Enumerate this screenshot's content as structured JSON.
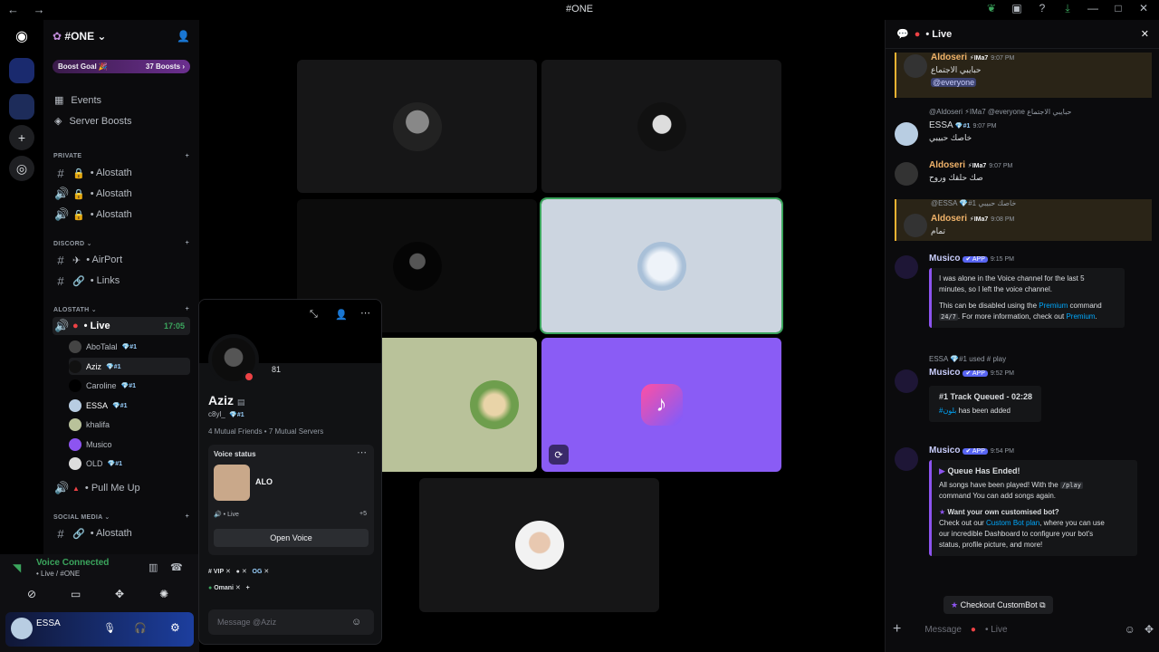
{
  "window": {
    "title": "#ONE",
    "nav": "← →"
  },
  "titlebar_icons": [
    "leaf-icon",
    "inbox-icon",
    "help-icon",
    "download-icon"
  ],
  "window_controls": [
    "—",
    "□",
    "✕"
  ],
  "server": {
    "name": "#ONE",
    "boost_label": "Boost Goal 🎉",
    "boost_count": "37 Boosts",
    "events": "Events",
    "server_boosts": "Server Boosts"
  },
  "categories": {
    "private": "PRIVATE",
    "discord": "DISCORD ⌄",
    "alostath": "ALOSTATH ⌄",
    "social": "SOCIAL MEDIA ⌄"
  },
  "channels": {
    "private": [
      "• Alostath",
      "• Alostath",
      "• Alostath"
    ],
    "discord": [
      "• AirPort",
      "• Links"
    ],
    "live": "• Live",
    "live_time": "17:05",
    "pull": "• Pull Me Up",
    "social": "• Alostath"
  },
  "members": [
    {
      "name": "AboTalal",
      "badge": "💎#1"
    },
    {
      "name": "Aziz",
      "badge": "💎#1"
    },
    {
      "name": "Caroline",
      "badge": "💎#1"
    },
    {
      "name": "ESSA",
      "badge": "💎#1"
    },
    {
      "name": "khalifa",
      "badge": ""
    },
    {
      "name": "Musico",
      "badge": ""
    },
    {
      "name": "OLD",
      "badge": "💎#1"
    }
  ],
  "voice": {
    "status": "Voice Connected",
    "sub": "• Live / #ONE"
  },
  "user": {
    "name": "ESSA"
  },
  "popup": {
    "name": "Aziz",
    "tag": "c8yl_",
    "tag_badge": "💎#1",
    "level": "81",
    "mutual": "4 Mutual Friends • 7 Mutual Servers",
    "voice_status_label": "Voice status",
    "server": "ALO",
    "channel": "• Live",
    "channel_more": "+5",
    "open_voice": "Open Voice",
    "roles": [
      "# VIP",
      "OG",
      "Omani"
    ],
    "message_placeholder": "Message @Aziz"
  },
  "chat": {
    "title": "• Live",
    "input_placeholder": "Message",
    "input_channel": "• Live",
    "messages": [
      {
        "user": "Aldoseri",
        "tag": "⚡IMa7",
        "time": "9:07 PM",
        "body": "حبايبي الاجتماع",
        "body2": "@everyone"
      },
      {
        "reply": "@Aldoseri ⚡IMa7 @everyone حبايبي الاجتماع",
        "user": "ESSA",
        "tag": "💎#1",
        "time": "9:07 PM",
        "body": "خاصك حبيبي"
      },
      {
        "user": "Aldoseri",
        "tag": "⚡IMa7",
        "time": "9:07 PM",
        "body": "صك حلقك وروح"
      },
      {
        "reply": "@ESSA 💎#1 خاصك حبيبي",
        "user": "Aldoseri",
        "tag": "⚡IMa7",
        "time": "9:08 PM",
        "body": "تمام"
      },
      {
        "user": "Musico",
        "tag": "✔ APP",
        "time": "9:15 PM",
        "embed_line1": "I was alone in the Voice channel for the last 5",
        "embed_line2": "minutes, so I left the voice channel.",
        "embed_line3a": "This can be disabled using the ",
        "embed_link1": "Premium",
        "embed_line3b": " command",
        "embed_code": "24/7",
        "embed_line4a": ". For more information, check out ",
        "embed_link2": "Premium",
        "embed_line4b": "."
      },
      {
        "reply": "ESSA 💎#1 used # play",
        "user": "Musico",
        "tag": "✔ APP",
        "time": "9:52 PM",
        "embed_title": "#1 Track Queued - 02:28",
        "embed_link": "#بلون",
        "embed_rest": " has been added"
      },
      {
        "user": "Musico",
        "tag": "✔ APP",
        "time": "9:54 PM",
        "embed_title": "Queue Has Ended!",
        "l1a": "All songs have been played! With the ",
        "l1code": "/play",
        "l2": "command You can add songs again.",
        "sub_title": "Want your own customised bot?",
        "l3a": "Check out our ",
        "l3link": "Custom Bot plan",
        "l3b": ", where you can use",
        "l4": "our incredible Dashboard to configure your bot's",
        "l5": "status, profile picture, and more!",
        "button": "Checkout CustomBot"
      }
    ]
  },
  "colors": {
    "accent": "#5865f2",
    "speaking": "#3ba55d",
    "bot_purple": "#8d54f0",
    "tile_purple": "#8a5cf5",
    "tile_green": "#b9c29a"
  }
}
